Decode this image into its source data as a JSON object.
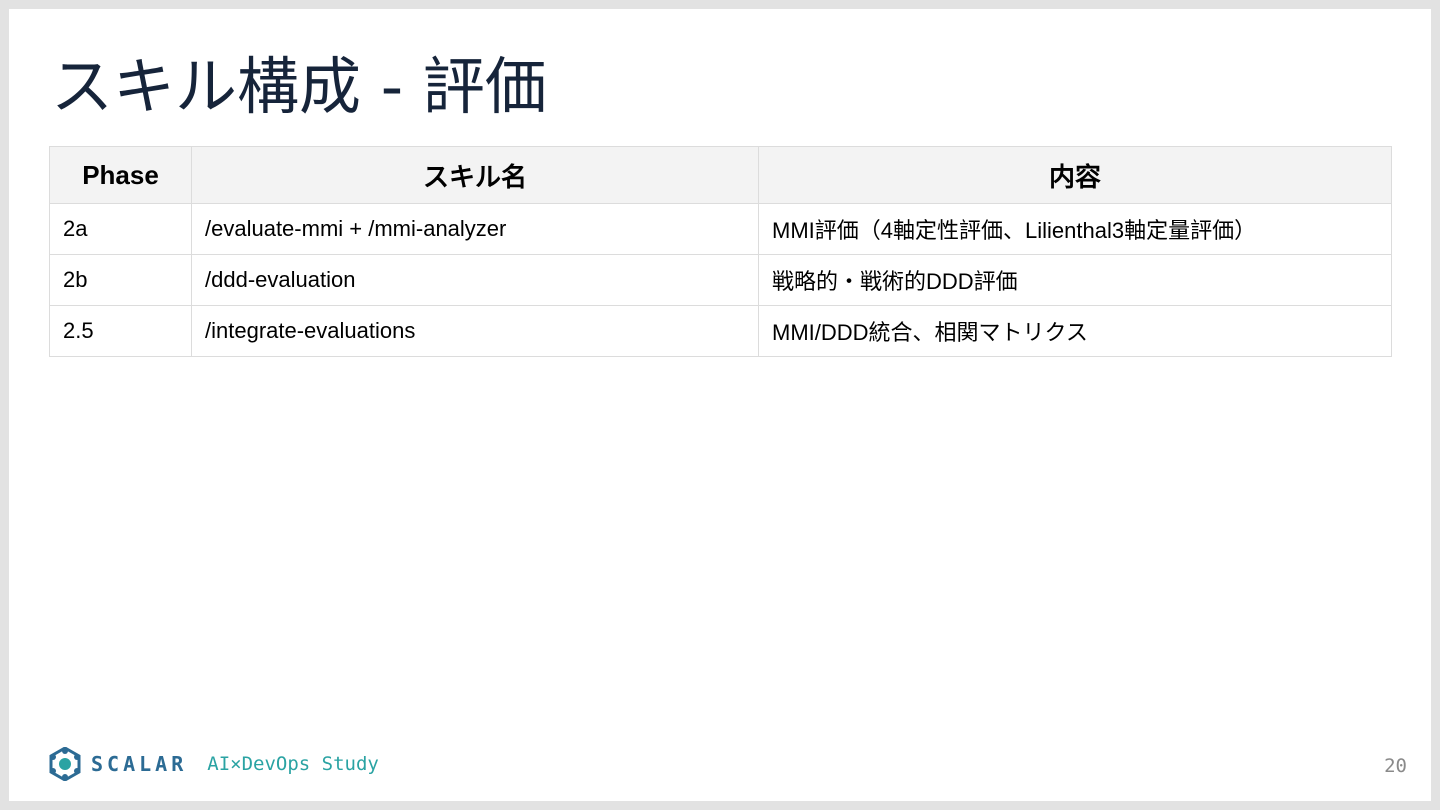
{
  "slide": {
    "title": "スキル構成 - 評価",
    "table": {
      "headers": [
        "Phase",
        "スキル名",
        "内容"
      ],
      "rows": [
        [
          "2a",
          "/evaluate-mmi + /mmi-analyzer",
          "MMI評価（4軸定性評価、Lilienthal3軸定量評価）"
        ],
        [
          "2b",
          "/ddd-evaluation",
          "戦略的・戦術的DDD評価"
        ],
        [
          "2.5",
          "/integrate-evaluations",
          "MMI/DDD統合、相関マトリクス"
        ]
      ]
    },
    "footer": {
      "logo_text": "SCALAR",
      "study_text": "AI×DevOps Study",
      "page_number": "20"
    }
  },
  "colors": {
    "title": "#16243a",
    "brand": "#2c6b94",
    "accent": "#2aa3a3",
    "header_bg": "#f3f3f3"
  }
}
